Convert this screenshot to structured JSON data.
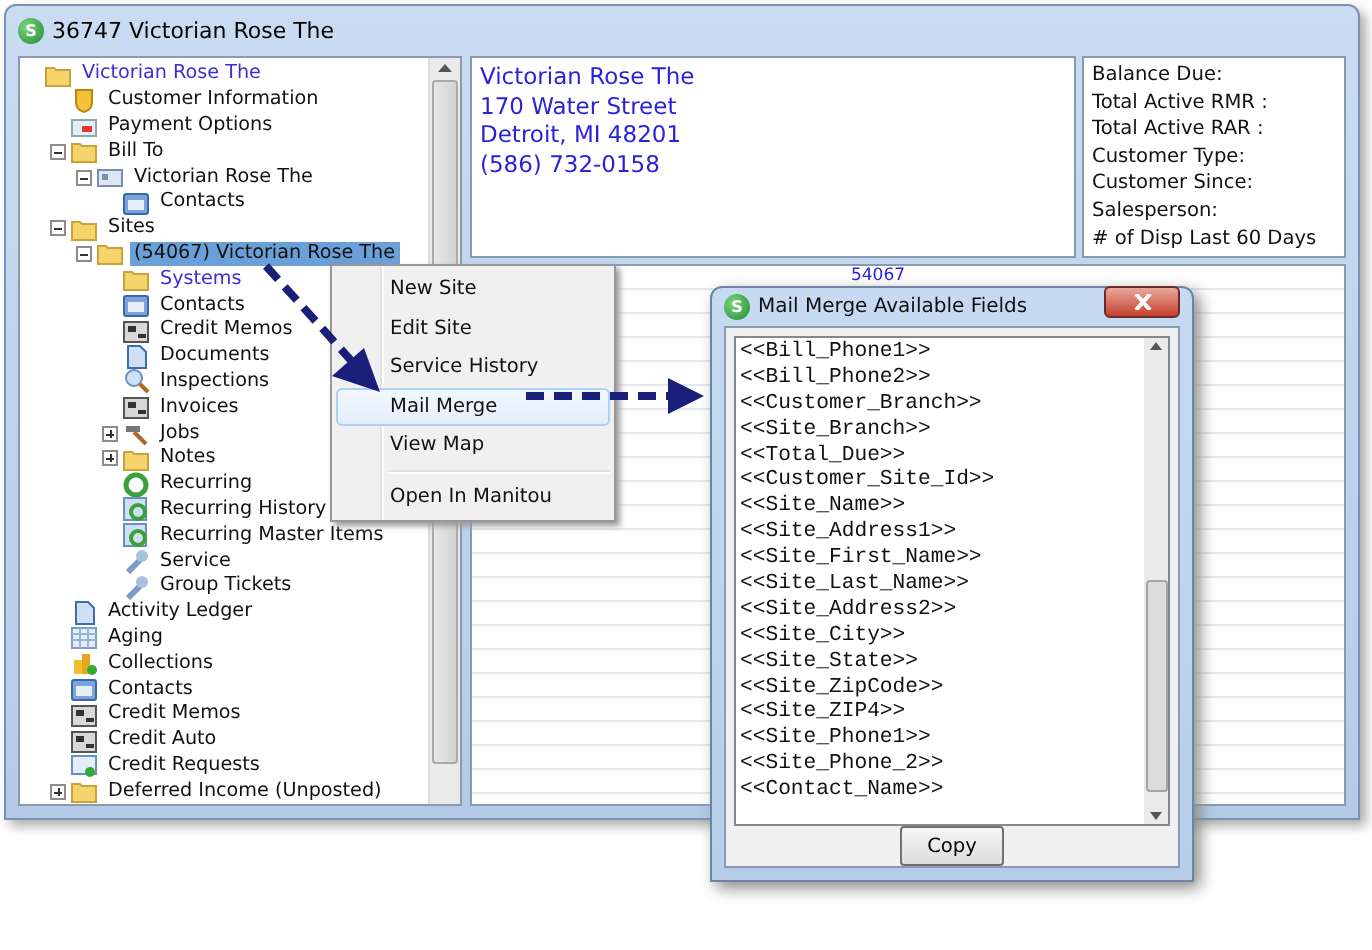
{
  "window": {
    "icon_letter": "S",
    "title": "36747  Victorian Rose  The"
  },
  "tree": [
    {
      "label": "Victorian Rose  The",
      "kind": "folder",
      "color": "#3a2fd0",
      "selected": false,
      "children": [
        {
          "label": "Customer Information",
          "kind": "shield",
          "selected": false
        },
        {
          "label": "Payment Options",
          "kind": "card",
          "selected": false
        },
        {
          "label": "Bill To",
          "kind": "folder",
          "selected": false,
          "expanded": true,
          "children": [
            {
              "label": "Victorian Rose  The",
              "kind": "idcard",
              "selected": false,
              "expanded": true,
              "children": [
                {
                  "label": "Contacts",
                  "kind": "contacts",
                  "selected": false
                }
              ]
            }
          ]
        },
        {
          "label": "Sites",
          "kind": "folder",
          "selected": false,
          "expanded": true,
          "children": [
            {
              "label": "(54067) Victorian Rose  The",
              "kind": "folder",
              "selected": true,
              "expanded": true,
              "children": [
                {
                  "label": "Systems",
                  "kind": "folder",
                  "color": "#3a2fd0",
                  "selected": false
                },
                {
                  "label": "Contacts",
                  "kind": "contacts",
                  "selected": false
                },
                {
                  "label": "Credit Memos",
                  "kind": "memo",
                  "selected": false
                },
                {
                  "label": "Documents",
                  "kind": "document",
                  "selected": false
                },
                {
                  "label": "Inspections",
                  "kind": "magnifier",
                  "selected": false
                },
                {
                  "label": "Invoices",
                  "kind": "memo",
                  "selected": false
                },
                {
                  "label": "Jobs",
                  "kind": "hammer",
                  "selected": false,
                  "expanded": false
                },
                {
                  "label": "Notes",
                  "kind": "folder",
                  "selected": false,
                  "expanded": false
                },
                {
                  "label": "Recurring",
                  "kind": "recur",
                  "selected": false
                },
                {
                  "label": "Recurring History",
                  "kind": "recurdoc",
                  "selected": false
                },
                {
                  "label": "Recurring Master Items",
                  "kind": "recurdoc",
                  "selected": false
                },
                {
                  "label": "Service",
                  "kind": "wrench",
                  "selected": false
                },
                {
                  "label": "Group Tickets",
                  "kind": "wrench",
                  "selected": false
                }
              ]
            }
          ]
        },
        {
          "label": "Activity Ledger",
          "kind": "document",
          "selected": false
        },
        {
          "label": "Aging",
          "kind": "grid",
          "selected": false
        },
        {
          "label": "Collections",
          "kind": "coins",
          "selected": false
        },
        {
          "label": "Contacts",
          "kind": "contacts",
          "selected": false
        },
        {
          "label": "Credit Memos",
          "kind": "memo",
          "selected": false
        },
        {
          "label": "Credit Auto",
          "kind": "memo",
          "selected": false
        },
        {
          "label": "Credit Requests",
          "kind": "request",
          "selected": false
        },
        {
          "label": "Deferred Income (Unposted)",
          "kind": "folder",
          "selected": false,
          "expanded": false
        }
      ]
    }
  ],
  "address": [
    "Victorian Rose  The",
    "170  Water Street",
    "Detroit, MI 48201",
    "(586) 732-0158"
  ],
  "summary_labels": [
    "Balance Due:",
    "Total Active RMR :",
    "Total Active RAR :",
    "Customer Type:",
    "Customer Since:",
    "Salesperson:",
    "# of Disp Last 60 Days"
  ],
  "grid_label": "54067",
  "context_menu": [
    {
      "label": "New Site",
      "selected": false
    },
    {
      "label": "Edit Site",
      "selected": false
    },
    {
      "label": "Service History",
      "selected": false
    },
    {
      "label": "Mail Merge",
      "selected": true
    },
    {
      "label": "View Map",
      "selected": false
    },
    {
      "label": "Open In Manitou",
      "selected": false,
      "separator_before": true
    }
  ],
  "dialog": {
    "icon_letter": "S",
    "title": "Mail Merge Available Fields",
    "fields": [
      "<<Bill_Phone1>>",
      "<<Bill_Phone2>>",
      "<<Customer_Branch>>",
      "<<Site_Branch>>",
      "<<Total_Due>>",
      "<<Customer_Site_Id>>",
      "<<Site_Name>>",
      "<<Site_Address1>>",
      "<<Site_First_Name>>",
      "<<Site_Last_Name>>",
      "<<Site_Address2>>",
      "<<Site_City>>",
      "<<Site_State>>",
      "<<Site_ZipCode>>",
      "<<Site_ZIP4>>",
      "<<Site_Phone1>>",
      "<<Site_Phone_2>>",
      "<<Contact_Name>>"
    ],
    "button": "Copy"
  }
}
